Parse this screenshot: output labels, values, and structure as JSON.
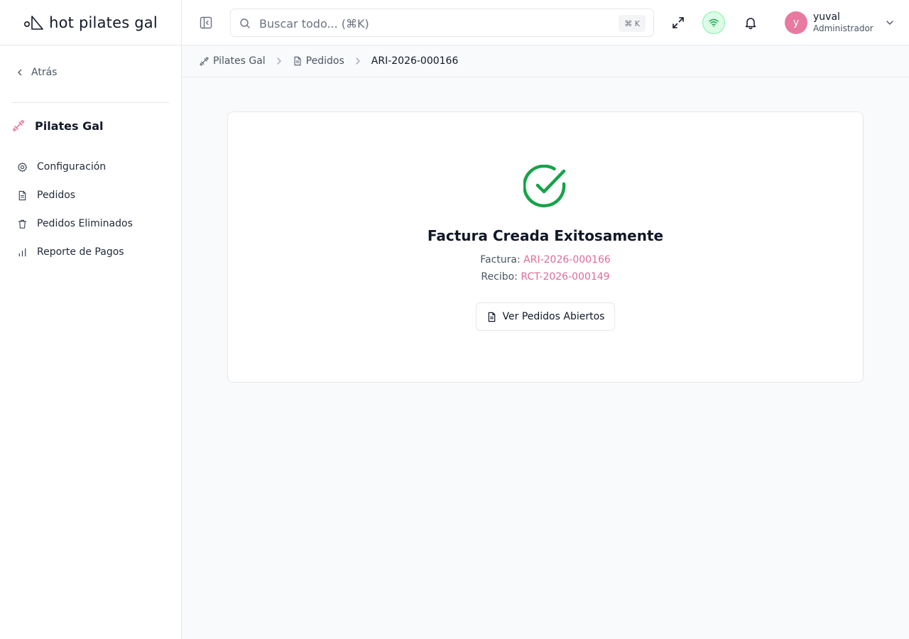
{
  "app": {
    "logo_text": "hot pilates gal"
  },
  "sidebar": {
    "back_label": "Atrás",
    "org_name": "Pilates Gal",
    "items": [
      {
        "label": "Configuración",
        "icon": "gear-icon"
      },
      {
        "label": "Pedidos",
        "icon": "document-icon"
      },
      {
        "label": "Pedidos Eliminados",
        "icon": "trash-icon"
      },
      {
        "label": "Reporte de Pagos",
        "icon": "bar-chart-icon"
      }
    ]
  },
  "header": {
    "search_placeholder": "Buscar todo... (⌘K)",
    "search_shortcut": "⌘ K",
    "user": {
      "initial": "y",
      "name": "yuval",
      "role": "Administrador"
    }
  },
  "breadcrumb": {
    "items": [
      {
        "label": "Pilates Gal",
        "icon": "dumbbell-icon"
      },
      {
        "label": "Pedidos",
        "icon": "document-icon"
      },
      {
        "label": "ARI-2026-000166"
      }
    ]
  },
  "success": {
    "title": "Factura Creada Exitosamente",
    "invoice_label": "Factura:",
    "invoice_number": "ARI-2026-000166",
    "receipt_label": "Recibo:",
    "receipt_number": "RCT-2026-000149",
    "button_label": "Ver Pedidos Abiertos"
  },
  "colors": {
    "accent_pink": "#e06b96",
    "success_green": "#16a34a",
    "avatar_bg": "#e879a1",
    "online_bg": "#dcfce7"
  }
}
